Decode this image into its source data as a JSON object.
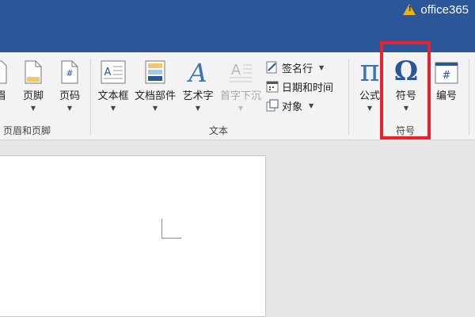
{
  "app": {
    "brand": "office365"
  },
  "ribbon": {
    "header_footer": {
      "group_label": "页眉和页脚",
      "header_label": "眉",
      "footer_label": "页脚",
      "page_number_label": "页码"
    },
    "text": {
      "group_label": "文本",
      "text_box_label": "文本框",
      "quick_parts_label": "文档部件",
      "wordart_label": "艺术字",
      "drop_cap_label": "首字下沉",
      "signature_line_label": "签名行",
      "date_time_label": "日期和时间",
      "object_label": "对象"
    },
    "symbols": {
      "group_label": "符号",
      "equation_label": "公式",
      "symbol_label": "符号",
      "number_label": "编号"
    }
  },
  "colors": {
    "title_bar": "#2b579a",
    "highlight": "#e8232d",
    "accent_blue": "#2b579a",
    "warning": "#e8b01a"
  }
}
